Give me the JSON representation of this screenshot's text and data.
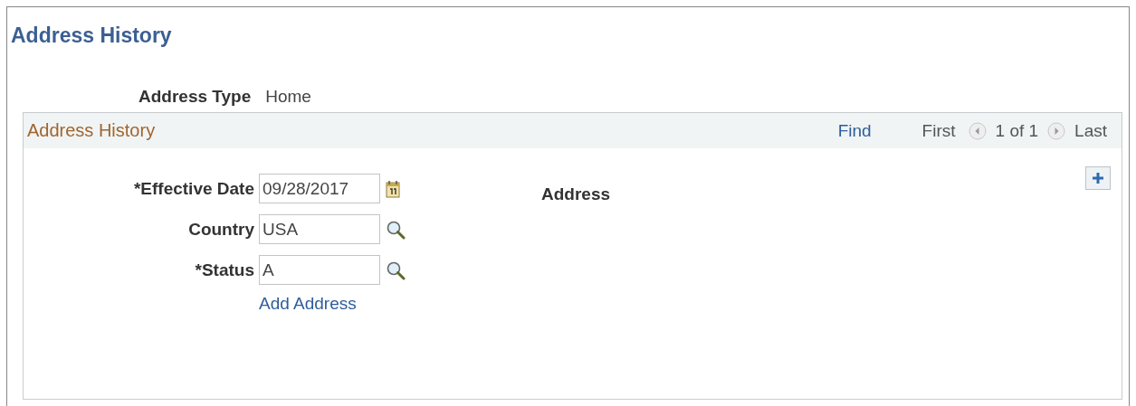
{
  "page_title": "Address History",
  "address_type": {
    "label": "Address Type",
    "value": "Home"
  },
  "grid": {
    "title": "Address History",
    "find": "Find",
    "first": "First",
    "count": "1 of 1",
    "last": "Last"
  },
  "fields": [
    {
      "label": "*Effective Date",
      "value": "09/28/2017",
      "kind": "date"
    },
    {
      "label": "Country",
      "value": "USA",
      "kind": "lookup"
    },
    {
      "label": "*Status",
      "value": "A",
      "kind": "lookup"
    }
  ],
  "add_address_link": "Add Address",
  "address_label": "Address"
}
